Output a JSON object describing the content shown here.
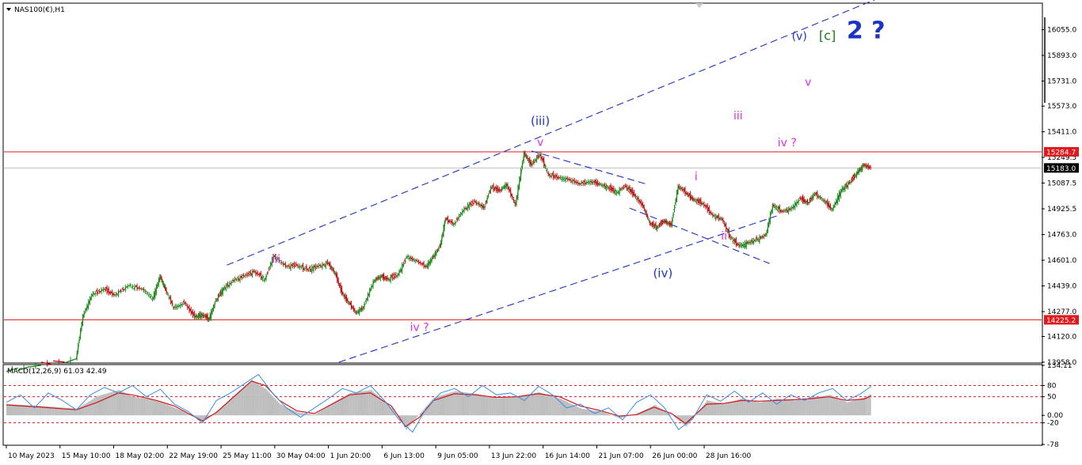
{
  "symbol_label": "NAS100(€),H1",
  "main": {
    "ylim": [
      13958.0,
      16217.0
    ],
    "y_ticks": [
      "16055.0",
      "15893.0",
      "15731.0",
      "15573.0",
      "15411.0",
      "15249.5",
      "15087.5",
      "14925.5",
      "14763.0",
      "14601.0",
      "14439.0",
      "14277.0",
      "14120.0",
      "13958.0"
    ],
    "h_levels": [
      {
        "value": 15284.7,
        "label": "15284.7",
        "color": "#e0191d",
        "kind": "red"
      },
      {
        "value": 15183.0,
        "label": "15183.0",
        "color": "#000000",
        "kind": "current"
      },
      {
        "value": 14225.2,
        "label": "14225.2",
        "color": "#e0191d",
        "kind": "red"
      }
    ],
    "price_path": [
      [
        0.0,
        13900
      ],
      [
        2.0,
        13980
      ],
      [
        2.2,
        14250
      ],
      [
        2.45,
        14380
      ],
      [
        2.8,
        14420
      ],
      [
        3.1,
        14380
      ],
      [
        3.5,
        14440
      ],
      [
        3.9,
        14420
      ],
      [
        4.2,
        14360
      ],
      [
        4.4,
        14500
      ],
      [
        4.55,
        14420
      ],
      [
        4.8,
        14300
      ],
      [
        5.1,
        14330
      ],
      [
        5.4,
        14240
      ],
      [
        5.6,
        14260
      ],
      [
        5.8,
        14230
      ],
      [
        6.0,
        14350
      ],
      [
        6.2,
        14420
      ],
      [
        6.5,
        14470
      ],
      [
        6.8,
        14500
      ],
      [
        7.1,
        14530
      ],
      [
        7.4,
        14480
      ],
      [
        7.65,
        14630
      ],
      [
        8.0,
        14560
      ],
      [
        8.3,
        14570
      ],
      [
        8.6,
        14540
      ],
      [
        8.9,
        14560
      ],
      [
        9.2,
        14580
      ],
      [
        9.4,
        14520
      ],
      [
        9.6,
        14390
      ],
      [
        9.8,
        14330
      ],
      [
        10.0,
        14270
      ],
      [
        10.2,
        14300
      ],
      [
        10.5,
        14470
      ],
      [
        10.7,
        14500
      ],
      [
        10.9,
        14480
      ],
      [
        11.2,
        14510
      ],
      [
        11.45,
        14620
      ],
      [
        11.7,
        14600
      ],
      [
        12.0,
        14560
      ],
      [
        12.2,
        14620
      ],
      [
        12.4,
        14690
      ],
      [
        12.55,
        14860
      ],
      [
        12.8,
        14830
      ],
      [
        13.1,
        14930
      ],
      [
        13.4,
        14970
      ],
      [
        13.65,
        14930
      ],
      [
        13.85,
        15060
      ],
      [
        14.1,
        15040
      ],
      [
        14.3,
        15080
      ],
      [
        14.55,
        14950
      ],
      [
        14.8,
        15280
      ],
      [
        15.0,
        15200
      ],
      [
        15.25,
        15270
      ],
      [
        15.5,
        15140
      ],
      [
        15.8,
        15120
      ],
      [
        16.1,
        15110
      ],
      [
        16.4,
        15080
      ],
      [
        16.7,
        15100
      ],
      [
        16.95,
        15080
      ],
      [
        17.2,
        15060
      ],
      [
        17.45,
        15030
      ],
      [
        17.7,
        15070
      ],
      [
        17.95,
        15010
      ],
      [
        18.2,
        14940
      ],
      [
        18.4,
        14830
      ],
      [
        18.6,
        14810
      ],
      [
        18.8,
        14850
      ],
      [
        19.0,
        14820
      ],
      [
        19.2,
        15070
      ],
      [
        19.45,
        15020
      ],
      [
        19.65,
        14980
      ],
      [
        19.9,
        14960
      ],
      [
        20.2,
        14880
      ],
      [
        20.45,
        14860
      ],
      [
        20.7,
        14740
      ],
      [
        20.95,
        14690
      ],
      [
        21.2,
        14710
      ],
      [
        21.45,
        14730
      ],
      [
        21.7,
        14760
      ],
      [
        21.9,
        14950
      ],
      [
        22.15,
        14910
      ],
      [
        22.4,
        14920
      ],
      [
        22.7,
        14990
      ],
      [
        22.9,
        14960
      ],
      [
        23.1,
        15020
      ],
      [
        23.35,
        14980
      ],
      [
        23.6,
        14920
      ],
      [
        23.85,
        15040
      ],
      [
        24.1,
        15090
      ],
      [
        24.3,
        15150
      ],
      [
        24.5,
        15200
      ],
      [
        24.7,
        15183
      ]
    ],
    "x_max": 29.5,
    "channel_lines": [
      {
        "x1": 6.3,
        "y1": 14570,
        "x2": 26.2,
        "y2": 16370
      },
      {
        "x1": 9.5,
        "y1": 13958,
        "x2": 22.0,
        "y2": 14880
      },
      {
        "x1": 17.8,
        "y1": 14930,
        "x2": 21.8,
        "y2": 14580
      },
      {
        "x1": 15.0,
        "y1": 15290,
        "x2": 18.3,
        "y2": 15080
      }
    ],
    "wave_labels": [
      {
        "text": "(v)",
        "x": 22.65,
        "y": 15990,
        "color": "#1b33c7",
        "size": 14
      },
      {
        "text": "[c]",
        "x": 23.45,
        "y": 15990,
        "color": "#1a7a1a",
        "size": 16
      },
      {
        "text": "2 ?",
        "x": 24.55,
        "y": 16000,
        "color": "#1b33c7",
        "size": 30
      },
      {
        "text": "v",
        "x": 22.9,
        "y": 15700,
        "color": "#e82adf",
        "size": 14
      },
      {
        "text": "iii",
        "x": 20.9,
        "y": 15490,
        "color": "#e82adf",
        "size": 14
      },
      {
        "text": "iv ?",
        "x": 22.3,
        "y": 15320,
        "color": "#e82adf",
        "size": 14
      },
      {
        "text": "(iii)",
        "x": 15.25,
        "y": 15455,
        "color": "#1b33c7",
        "size": 15
      },
      {
        "text": "v",
        "x": 15.25,
        "y": 15322,
        "color": "#e82adf",
        "size": 14
      },
      {
        "text": "i",
        "x": 19.7,
        "y": 15104,
        "color": "#e82adf",
        "size": 14
      },
      {
        "text": "ii",
        "x": 20.5,
        "y": 14732,
        "color": "#e82adf",
        "size": 14
      },
      {
        "text": "(iv)",
        "x": 18.75,
        "y": 14495,
        "color": "#1b33c7",
        "size": 15
      },
      {
        "text": "iii",
        "x": 7.7,
        "y": 14585,
        "color": "#e82adf",
        "size": 14
      },
      {
        "text": "iv ?",
        "x": 11.8,
        "y": 14155,
        "color": "#e82adf",
        "size": 14
      }
    ]
  },
  "macd": {
    "label": "MACD(12,26,9) 61.03 42.49",
    "ylim": [
      -78.0,
      134.11
    ],
    "y_ticks": [
      "134.11",
      "80",
      "50",
      "0.00",
      "-20",
      "-78"
    ],
    "dotted_levels": [
      80,
      50,
      -20
    ],
    "hist_path": [
      [
        0,
        30
      ],
      [
        1,
        25
      ],
      [
        2,
        18
      ],
      [
        2.6,
        52
      ],
      [
        3.2,
        68
      ],
      [
        3.6,
        50
      ],
      [
        4.3,
        40
      ],
      [
        4.8,
        20
      ],
      [
        5.2,
        5
      ],
      [
        5.6,
        -18
      ],
      [
        6.0,
        10
      ],
      [
        6.5,
        55
      ],
      [
        7.0,
        95
      ],
      [
        7.4,
        70
      ],
      [
        7.8,
        30
      ],
      [
        8.3,
        8
      ],
      [
        8.8,
        2
      ],
      [
        9.2,
        28
      ],
      [
        9.8,
        60
      ],
      [
        10.4,
        68
      ],
      [
        11.0,
        20
      ],
      [
        11.4,
        -38
      ],
      [
        11.8,
        5
      ],
      [
        12.2,
        48
      ],
      [
        12.8,
        65
      ],
      [
        13.4,
        58
      ],
      [
        14.0,
        45
      ],
      [
        14.6,
        52
      ],
      [
        15.2,
        62
      ],
      [
        15.8,
        45
      ],
      [
        16.4,
        18
      ],
      [
        17.0,
        10
      ],
      [
        17.5,
        -8
      ],
      [
        18.0,
        5
      ],
      [
        18.5,
        28
      ],
      [
        19.0,
        0
      ],
      [
        19.4,
        -30
      ],
      [
        20.0,
        40
      ],
      [
        20.5,
        30
      ],
      [
        21.0,
        46
      ],
      [
        21.5,
        35
      ],
      [
        22.0,
        45
      ],
      [
        22.5,
        40
      ],
      [
        23.0,
        48
      ],
      [
        23.5,
        55
      ],
      [
        24.0,
        35
      ],
      [
        24.5,
        48
      ],
      [
        24.7,
        60
      ]
    ],
    "signal_path": [
      [
        0,
        28
      ],
      [
        1,
        22
      ],
      [
        2,
        15
      ],
      [
        2.6,
        35
      ],
      [
        3.2,
        60
      ],
      [
        3.6,
        55
      ],
      [
        4.3,
        40
      ],
      [
        4.8,
        25
      ],
      [
        5.2,
        5
      ],
      [
        5.6,
        -15
      ],
      [
        6.0,
        8
      ],
      [
        6.5,
        50
      ],
      [
        7.0,
        92
      ],
      [
        7.4,
        80
      ],
      [
        7.8,
        40
      ],
      [
        8.3,
        12
      ],
      [
        8.8,
        5
      ],
      [
        9.2,
        25
      ],
      [
        9.8,
        55
      ],
      [
        10.4,
        60
      ],
      [
        11.0,
        25
      ],
      [
        11.4,
        -30
      ],
      [
        11.8,
        -5
      ],
      [
        12.2,
        40
      ],
      [
        12.8,
        58
      ],
      [
        13.4,
        55
      ],
      [
        14.0,
        48
      ],
      [
        14.6,
        50
      ],
      [
        15.2,
        58
      ],
      [
        15.8,
        50
      ],
      [
        16.4,
        25
      ],
      [
        17.0,
        12
      ],
      [
        17.5,
        -2
      ],
      [
        18.0,
        2
      ],
      [
        18.5,
        22
      ],
      [
        19.0,
        5
      ],
      [
        19.4,
        -22
      ],
      [
        20.0,
        30
      ],
      [
        20.5,
        32
      ],
      [
        21.0,
        40
      ],
      [
        21.5,
        38
      ],
      [
        22.0,
        40
      ],
      [
        22.5,
        42
      ],
      [
        23.0,
        45
      ],
      [
        23.5,
        50
      ],
      [
        24.0,
        40
      ],
      [
        24.5,
        44
      ],
      [
        24.7,
        52
      ]
    ],
    "macd_path": [
      [
        0,
        35
      ],
      [
        0.4,
        55
      ],
      [
        0.8,
        20
      ],
      [
        1.2,
        60
      ],
      [
        1.6,
        40
      ],
      [
        2.0,
        15
      ],
      [
        2.4,
        55
      ],
      [
        2.8,
        75
      ],
      [
        3.2,
        60
      ],
      [
        3.6,
        80
      ],
      [
        4.0,
        50
      ],
      [
        4.4,
        70
      ],
      [
        4.8,
        30
      ],
      [
        5.2,
        10
      ],
      [
        5.6,
        -20
      ],
      [
        6.0,
        40
      ],
      [
        6.4,
        60
      ],
      [
        6.8,
        85
      ],
      [
        7.2,
        110
      ],
      [
        7.6,
        60
      ],
      [
        8.0,
        20
      ],
      [
        8.4,
        -5
      ],
      [
        8.8,
        20
      ],
      [
        9.2,
        45
      ],
      [
        9.6,
        72
      ],
      [
        10.0,
        60
      ],
      [
        10.4,
        80
      ],
      [
        10.8,
        40
      ],
      [
        11.2,
        -10
      ],
      [
        11.6,
        -45
      ],
      [
        12.0,
        20
      ],
      [
        12.4,
        60
      ],
      [
        12.8,
        72
      ],
      [
        13.2,
        50
      ],
      [
        13.6,
        80
      ],
      [
        14.0,
        55
      ],
      [
        14.4,
        60
      ],
      [
        14.8,
        40
      ],
      [
        15.2,
        78
      ],
      [
        15.6,
        55
      ],
      [
        16.0,
        20
      ],
      [
        16.4,
        30
      ],
      [
        16.8,
        5
      ],
      [
        17.2,
        20
      ],
      [
        17.6,
        -12
      ],
      [
        18.0,
        35
      ],
      [
        18.4,
        55
      ],
      [
        18.8,
        20
      ],
      [
        19.2,
        -38
      ],
      [
        19.6,
        -10
      ],
      [
        20.0,
        55
      ],
      [
        20.4,
        38
      ],
      [
        20.8,
        65
      ],
      [
        21.2,
        35
      ],
      [
        21.6,
        60
      ],
      [
        22.0,
        30
      ],
      [
        22.4,
        55
      ],
      [
        22.8,
        40
      ],
      [
        23.2,
        60
      ],
      [
        23.6,
        72
      ],
      [
        24.0,
        40
      ],
      [
        24.4,
        58
      ],
      [
        24.7,
        78
      ]
    ]
  },
  "x_axis": {
    "labels": [
      {
        "text": "10 May 2023",
        "x": 0.0
      },
      {
        "text": "15 May 10:00",
        "x": 2.15
      },
      {
        "text": "18 May 02:00",
        "x": 4.3
      },
      {
        "text": "22 May 19:00",
        "x": 6.45
      },
      {
        "text": "25 May 11:00",
        "x": 8.6
      },
      {
        "text": "30 May 04:00",
        "x": 10.75
      },
      {
        "text": "1 Jun 20:00",
        "x": 12.9
      },
      {
        "text": "6 Jun 13:00",
        "x": 15.05
      },
      {
        "text": "9 Jun 05:00",
        "x": 17.2
      },
      {
        "text": "13 Jun 22:00",
        "x": 19.35
      },
      {
        "text": "16 Jun 14:00",
        "x": 21.5
      },
      {
        "text": "21 Jun 07:00",
        "x": 23.65
      },
      {
        "text": "26 Jun 00:00",
        "x": 25.8
      },
      {
        "text": "28 Jun 16:00",
        "x": 27.95
      }
    ]
  },
  "chart_data": {
    "type": "line",
    "title": "NAS100(€),H1",
    "xlabel": "",
    "ylabel": "",
    "ylim": [
      13958.0,
      16217.0
    ],
    "categories": [
      "10 May 2023",
      "15 May 10:00",
      "18 May 02:00",
      "22 May 19:00",
      "25 May 11:00",
      "30 May 04:00",
      "1 Jun 20:00",
      "6 Jun 13:00",
      "9 Jun 05:00",
      "13 Jun 22:00",
      "16 Jun 14:00",
      "21 Jun 07:00",
      "26 Jun 00:00",
      "28 Jun 16:00"
    ],
    "horizontal_levels": [
      15284.7,
      15183.0,
      14225.2
    ],
    "annotations": [
      "(v)",
      "[c]",
      "2 ?",
      "v",
      "iii",
      "iv ?",
      "(iii)",
      "v",
      "i",
      "ii",
      "(iv)",
      "iii",
      "iv ?"
    ],
    "indicator": {
      "name": "MACD(12,26,9) 61.03 42.49",
      "ylim": [
        -78.0,
        134.11
      ],
      "levels": [
        80,
        50,
        0,
        -20
      ]
    }
  }
}
